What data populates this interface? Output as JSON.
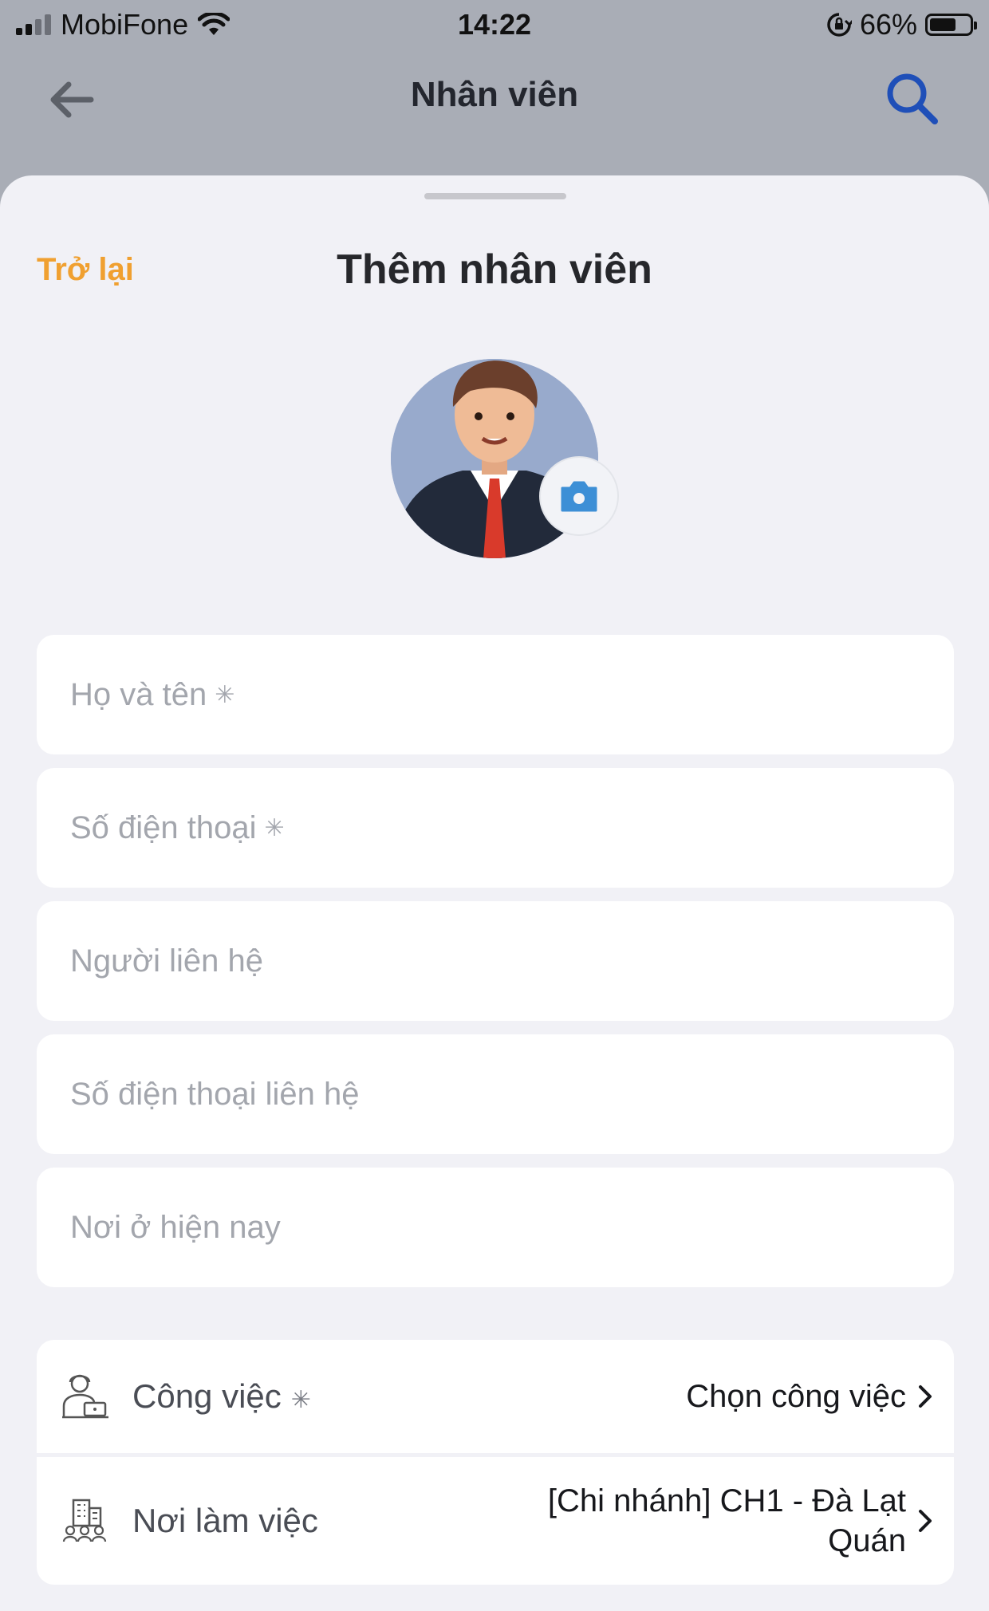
{
  "status_bar": {
    "carrier": "MobiFone",
    "time": "14:22",
    "battery_percent": "66%",
    "battery_level": 0.66
  },
  "nav": {
    "title": "Nhân viên",
    "back_icon": "arrow-left-icon",
    "search_icon": "search-icon"
  },
  "sheet": {
    "back_label": "Trở lại",
    "title": "Thêm nhân viên"
  },
  "form": {
    "fields": [
      {
        "placeholder": "Họ và tên",
        "required": "✳"
      },
      {
        "placeholder": "Số điện thoại",
        "required": "✳"
      },
      {
        "placeholder": "Người liên hệ",
        "required": ""
      },
      {
        "placeholder": "Số điện thoại liên hệ",
        "required": ""
      },
      {
        "placeholder": "Nơi ở hiện nay",
        "required": ""
      }
    ],
    "job": {
      "label": "Công việc",
      "required": "✳",
      "value": "Chọn công việc",
      "icon": "worker-icon"
    },
    "workplace": {
      "label": "Nơi làm việc",
      "value_line1": "[Chi nhánh] CH1 - Đà Lạt",
      "value_line2": "Quán",
      "icon": "building-icon"
    }
  },
  "colors": {
    "accent": "#f0a030",
    "search_blue": "#1f4fb8",
    "camera_blue": "#3d8fd6",
    "sheet_bg": "#f1f1f6"
  }
}
